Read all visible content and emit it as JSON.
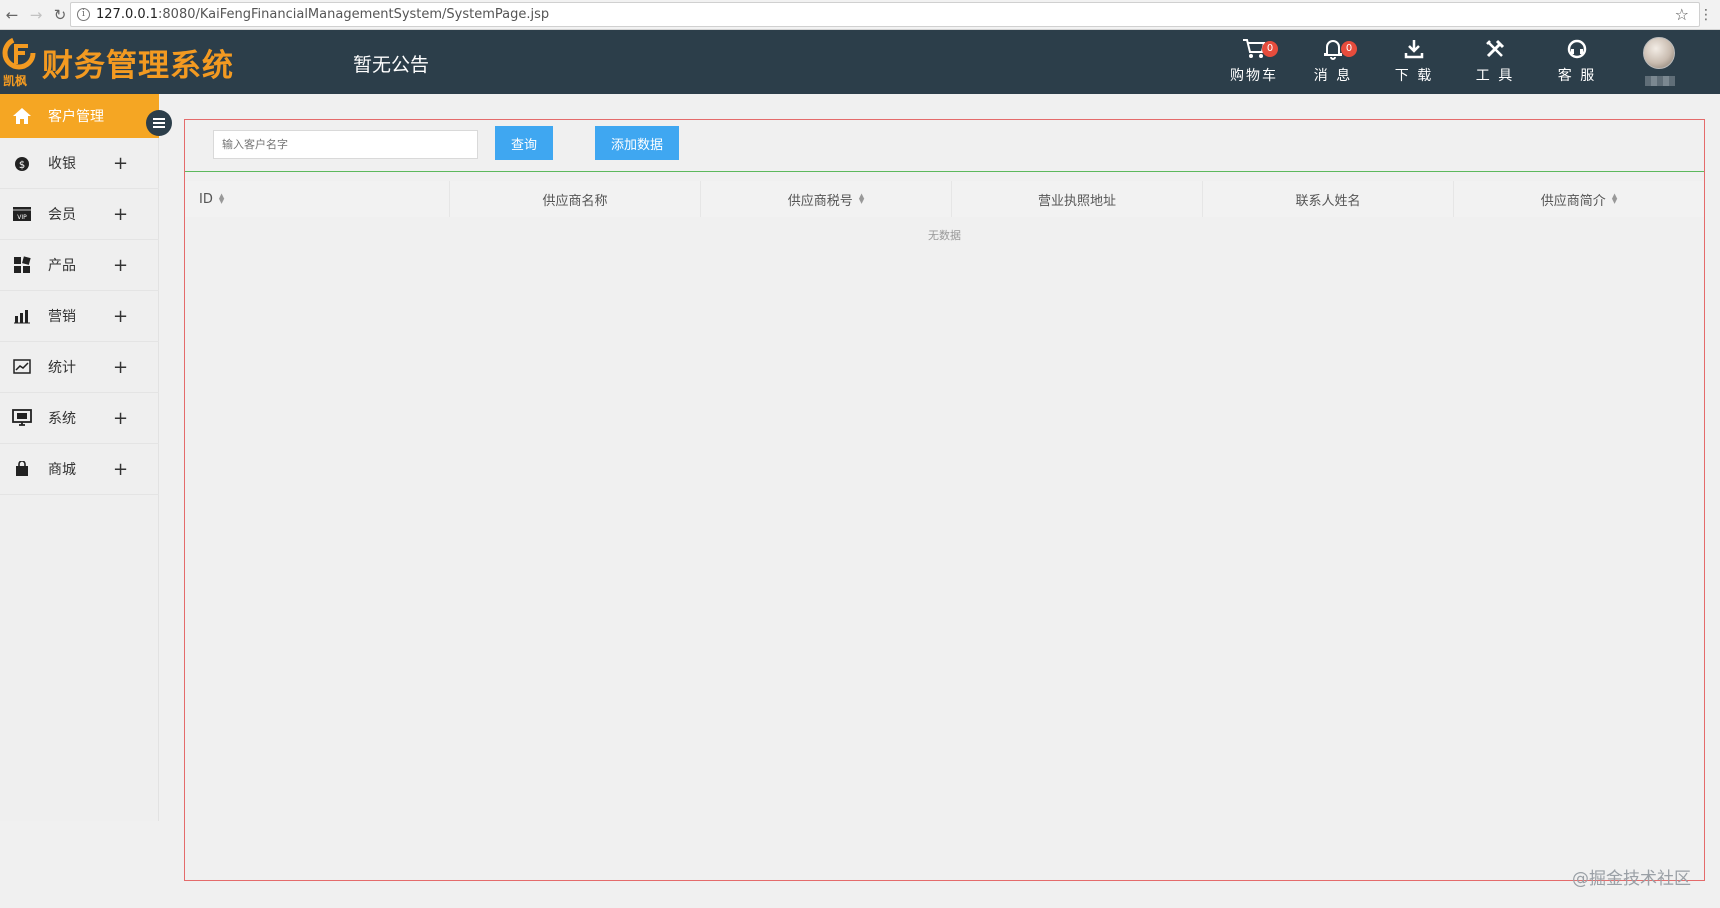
{
  "browser": {
    "url_host": "127.0.0.1",
    "url_path": ":8080/KaiFengFinancialManagementSystem/SystemPage.jsp"
  },
  "header": {
    "logo_sub": "凯枫",
    "app_title": "财务管理系统",
    "notice": "暂无公告",
    "items": [
      {
        "label": "购物车",
        "icon": "cart-icon",
        "badge": "0"
      },
      {
        "label": "消 息",
        "icon": "bell-icon",
        "badge": "0"
      },
      {
        "label": "下 载",
        "icon": "download-icon"
      },
      {
        "label": "工 具",
        "icon": "tools-icon"
      },
      {
        "label": "客 服",
        "icon": "headset-icon"
      }
    ]
  },
  "sidebar": {
    "active": {
      "label": "客户管理",
      "icon": "home-icon"
    },
    "items": [
      {
        "label": "收银",
        "icon": "moneybag-icon"
      },
      {
        "label": "会员",
        "icon": "vip-card-icon"
      },
      {
        "label": "产品",
        "icon": "grid-icon"
      },
      {
        "label": "营销",
        "icon": "bar-chart-icon"
      },
      {
        "label": "统计",
        "icon": "line-chart-icon"
      },
      {
        "label": "系统",
        "icon": "monitor-icon"
      },
      {
        "label": "商城",
        "icon": "shopping-bag-icon"
      }
    ],
    "expand_symbol": "+"
  },
  "toolbar": {
    "search_placeholder": "输入客户名字",
    "query_label": "查询",
    "add_label": "添加数据"
  },
  "table": {
    "columns": [
      "ID",
      "供应商名称",
      "供应商税号",
      "营业执照地址",
      "联系人姓名",
      "供应商简介"
    ],
    "empty_text": "无数据"
  },
  "watermark": "@掘金技术社区",
  "colors": {
    "header_bg": "#2c3e4a",
    "brand_orange": "#f39a21",
    "active_item": "#f5a623",
    "button_blue": "#3fa7f1",
    "badge_red": "#e74c3c",
    "panel_border": "#e46b6b",
    "toolbar_divider": "#5cb85c"
  }
}
